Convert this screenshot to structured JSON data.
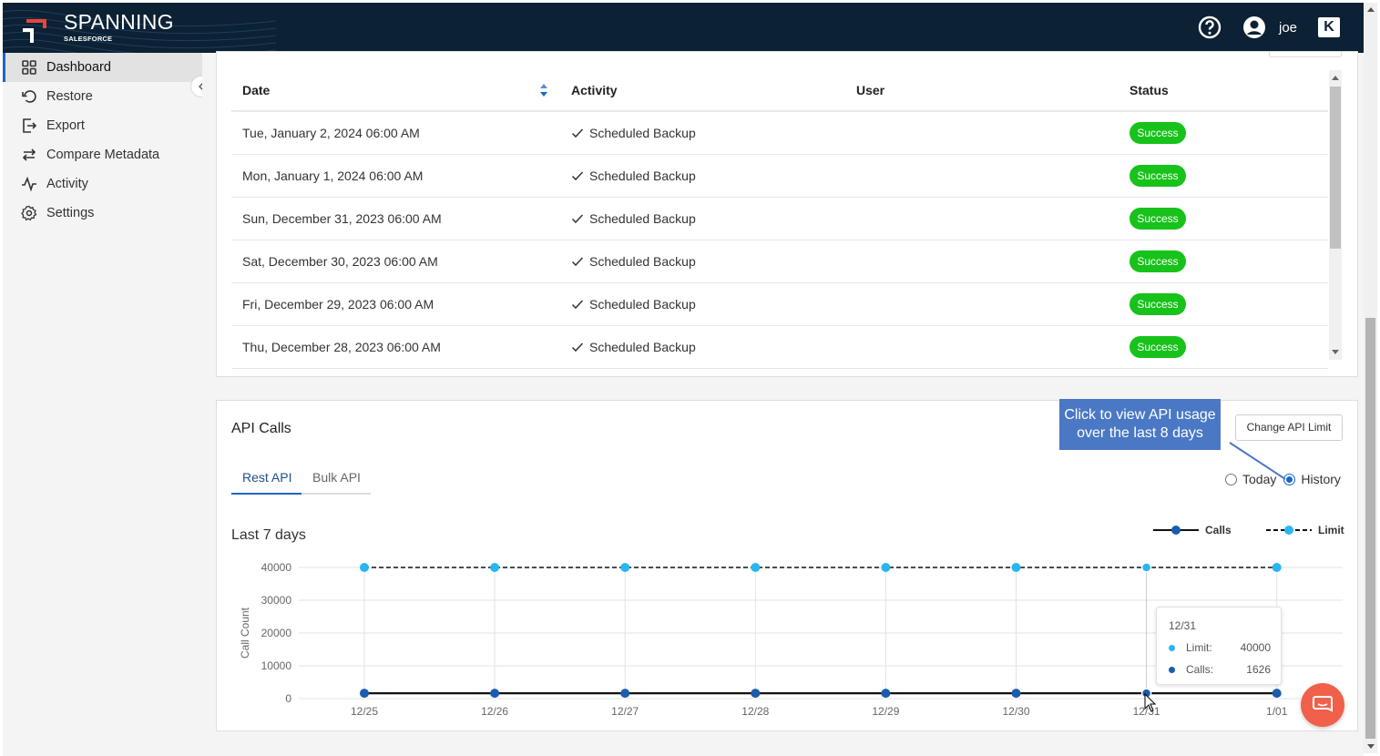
{
  "header": {
    "brand": "SPANNING",
    "brand_sub": "SALESFORCE",
    "user_name": "joe",
    "brand_badge": "K"
  },
  "sidebar": {
    "items": [
      {
        "label": "Dashboard",
        "icon": "dashboard-grid-icon",
        "active": true
      },
      {
        "label": "Restore",
        "icon": "restore-icon"
      },
      {
        "label": "Export",
        "icon": "export-icon"
      },
      {
        "label": "Compare Metadata",
        "icon": "compare-arrows-icon"
      },
      {
        "label": "Activity",
        "icon": "activity-pulse-icon"
      },
      {
        "label": "Settings",
        "icon": "gear-icon"
      }
    ]
  },
  "activity_table": {
    "columns": [
      "Date",
      "Activity",
      "User",
      "Status"
    ],
    "rows": [
      {
        "date": "Tue, January 2, 2024 06:00 AM",
        "activity": "Scheduled Backup",
        "user": "",
        "status": "Success"
      },
      {
        "date": "Mon, January 1, 2024 06:00 AM",
        "activity": "Scheduled Backup",
        "user": "",
        "status": "Success"
      },
      {
        "date": "Sun, December 31, 2023 06:00 AM",
        "activity": "Scheduled Backup",
        "user": "",
        "status": "Success"
      },
      {
        "date": "Sat, December 30, 2023 06:00 AM",
        "activity": "Scheduled Backup",
        "user": "",
        "status": "Success"
      },
      {
        "date": "Fri, December 29, 2023 06:00 AM",
        "activity": "Scheduled Backup",
        "user": "",
        "status": "Success"
      },
      {
        "date": "Thu, December 28, 2023 06:00 AM",
        "activity": "Scheduled Backup",
        "user": "",
        "status": "Success"
      }
    ],
    "status_color": "#17c21a"
  },
  "api": {
    "title": "API Calls",
    "tabs": [
      "Rest API",
      "Bulk API"
    ],
    "change_limit_label": "Change API Limit",
    "radio_today": "Today",
    "radio_history": "History",
    "selected_range": "History",
    "callout_line1": "Click to view API usage",
    "callout_line2": "over the last 8 days",
    "subtitle": "Last 7 days",
    "tooltip": {
      "date": "12/31",
      "limit_label": "Limit:",
      "limit_value": "40000",
      "calls_label": "Calls:",
      "calls_value": "1626"
    }
  },
  "chart_data": {
    "type": "line",
    "title": "",
    "xlabel": "",
    "ylabel": "Call Count",
    "x": [
      "12/25",
      "12/26",
      "12/27",
      "12/28",
      "12/29",
      "12/30",
      "12/31",
      "1/01"
    ],
    "ylim": [
      0,
      40000
    ],
    "yticks": [
      "40000",
      "30000",
      "20000",
      "10000",
      "0"
    ],
    "legend_position": "top-right",
    "grid": true,
    "series": [
      {
        "name": "Calls",
        "values": [
          1626,
          1626,
          1626,
          1626,
          1626,
          1626,
          1626,
          1626
        ],
        "color": "#1a5cae",
        "style": "solid"
      },
      {
        "name": "Limit",
        "values": [
          40000,
          40000,
          40000,
          40000,
          40000,
          40000,
          40000,
          40000
        ],
        "color": "#29b6f0",
        "style": "dashed"
      }
    ]
  },
  "colors": {
    "header_bg": "#0c2134",
    "accent": "#1b67c2",
    "chat_button": "#f1604b",
    "callout": "#4a78c4"
  }
}
